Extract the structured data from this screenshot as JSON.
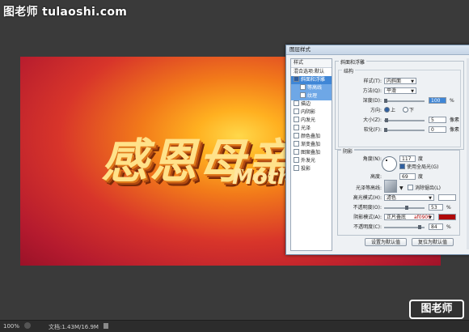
{
  "watermark_top": "图老师 tulaoshi.com",
  "watermark_bottom": "图老师",
  "canvas": {
    "main_text": "感恩母亲",
    "sub_text": "Mother"
  },
  "status": {
    "zoom": "100%",
    "doc": "文档:1.43M/16.9M"
  },
  "dialog": {
    "title": "图层样式",
    "sidebar": {
      "header": "样式",
      "blend": "混合选项:默认",
      "items": [
        {
          "label": "斜面和浮雕",
          "checked": true,
          "selected": true
        },
        {
          "label": "等高线",
          "checked": false,
          "sub": true
        },
        {
          "label": "纹理",
          "checked": false,
          "sub": true
        },
        {
          "label": "描边",
          "checked": false
        },
        {
          "label": "内阴影",
          "checked": false
        },
        {
          "label": "内发光",
          "checked": false
        },
        {
          "label": "光泽",
          "checked": false
        },
        {
          "label": "颜色叠加",
          "checked": false
        },
        {
          "label": "渐变叠加",
          "checked": false
        },
        {
          "label": "图案叠加",
          "checked": false
        },
        {
          "label": "外发光",
          "checked": false
        },
        {
          "label": "投影",
          "checked": false
        }
      ]
    },
    "bevel": {
      "group_title": "斜面和浮雕",
      "structure_title": "结构",
      "style_label": "样式(T):",
      "style_value": "内斜面",
      "method_label": "方法(Q):",
      "method_value": "平滑",
      "depth_label": "深度(D):",
      "depth_value": "100",
      "depth_unit": "%",
      "depth_level": 0.1,
      "direction_label": "方向:",
      "dir_up": "上",
      "dir_down": "下",
      "size_label": "大小(Z):",
      "size_value": "5",
      "size_unit": "像素",
      "soften_label": "软化(F):",
      "soften_value": "0",
      "soften_unit": "像素"
    },
    "shading": {
      "title": "阴影",
      "angle_label": "角度(N):",
      "angle_value": "117",
      "angle_unit": "度",
      "global_light": "使用全局光(G)",
      "altitude_label": "高度:",
      "altitude_value": "69",
      "altitude_unit": "度",
      "gloss_label": "光泽等高线:",
      "antialias": "消除锯齿(L)",
      "highlight_label": "高光模式(H):",
      "highlight_value": "滤色",
      "highlight_color": "#ffffff",
      "hi_opacity_label": "不透明度(O):",
      "hi_opacity_value": "53",
      "hi_opacity_unit": "%",
      "shadow_label": "阴影模式(A):",
      "shadow_value": "正片叠底",
      "shadow_hex": "af0909",
      "shadow_color": "#af0909",
      "sh_opacity_label": "不透明度(C):",
      "sh_opacity_value": "84",
      "sh_opacity_unit": "%"
    },
    "buttons": {
      "make_default": "设置为默认值",
      "reset_default": "复位为默认值"
    }
  }
}
